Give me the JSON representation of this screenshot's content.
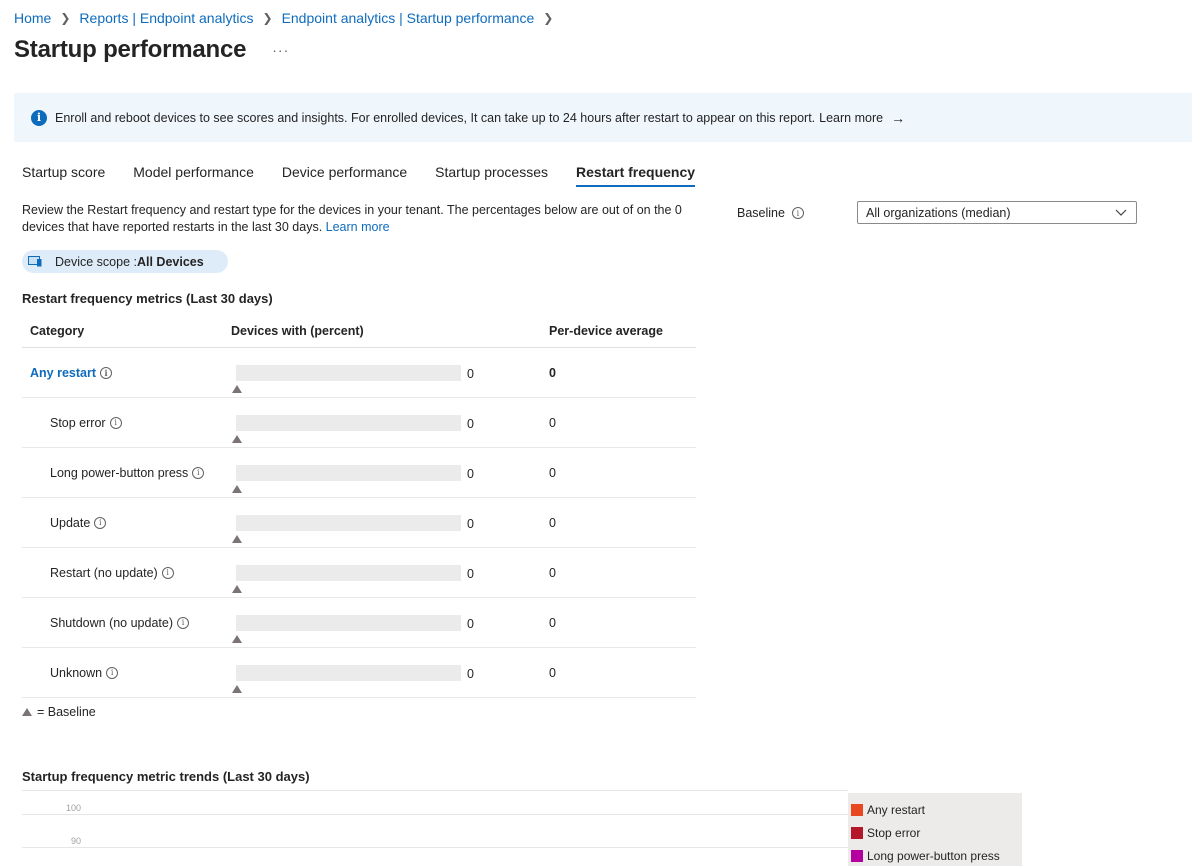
{
  "breadcrumb": {
    "items": [
      "Home",
      "Reports | Endpoint analytics",
      "Endpoint analytics | Startup performance"
    ]
  },
  "page": {
    "title": "Startup performance",
    "more": "···"
  },
  "banner": {
    "text": "Enroll and reboot devices to see scores and insights. For enrolled devices, It can take up to 24 hours after restart to appear on this report.",
    "learn_more": "Learn more",
    "arrow": "→"
  },
  "tabs": [
    {
      "label": "Startup score"
    },
    {
      "label": "Model performance"
    },
    {
      "label": "Device performance"
    },
    {
      "label": "Startup processes"
    },
    {
      "label": "Restart frequency",
      "active": true
    }
  ],
  "description": {
    "text": "Review the Restart frequency and restart type for the devices in your tenant. The percentages below are out of on the 0 devices that have reported restarts in the last 30 days.",
    "learn_more": "Learn more"
  },
  "baseline": {
    "label": "Baseline",
    "selected": "All organizations (median)"
  },
  "scope": {
    "label": "Device scope : ",
    "value": "All Devices"
  },
  "metrics": {
    "title": "Restart frequency metrics (Last 30 days)",
    "columns": [
      "Category",
      "Devices with (percent)",
      "Per-device average"
    ],
    "rows": [
      {
        "category": "Any restart",
        "percent": 0,
        "percent_label": "0",
        "average": "0",
        "level": "top"
      },
      {
        "category": "Stop error",
        "percent": 0,
        "percent_label": "0",
        "average": "0",
        "level": "sub"
      },
      {
        "category": "Long power-button press",
        "percent": 0,
        "percent_label": "0",
        "average": "0",
        "level": "sub"
      },
      {
        "category": "Update",
        "percent": 0,
        "percent_label": "0",
        "average": "0",
        "level": "sub"
      },
      {
        "category": "Restart (no update)",
        "percent": 0,
        "percent_label": "0",
        "average": "0",
        "level": "sub"
      },
      {
        "category": "Shutdown (no update)",
        "percent": 0,
        "percent_label": "0",
        "average": "0",
        "level": "sub"
      },
      {
        "category": "Unknown",
        "percent": 0,
        "percent_label": "0",
        "average": "0",
        "level": "sub"
      }
    ],
    "baseline_legend": "= Baseline"
  },
  "trends": {
    "title": "Startup frequency metric trends (Last 30 days)",
    "y_ticks": [
      "100",
      "90"
    ],
    "legend": [
      {
        "name": "Any restart",
        "color": "#e8471f"
      },
      {
        "name": "Stop error",
        "color": "#b4162a"
      },
      {
        "name": "Long power-button press",
        "color": "#b4009e"
      }
    ]
  },
  "colors": {
    "accent": "#0f6cbd",
    "banner_bg": "#eff6fc",
    "bar_track": "#ebebeb",
    "baseline_marker": "#7a7574"
  }
}
